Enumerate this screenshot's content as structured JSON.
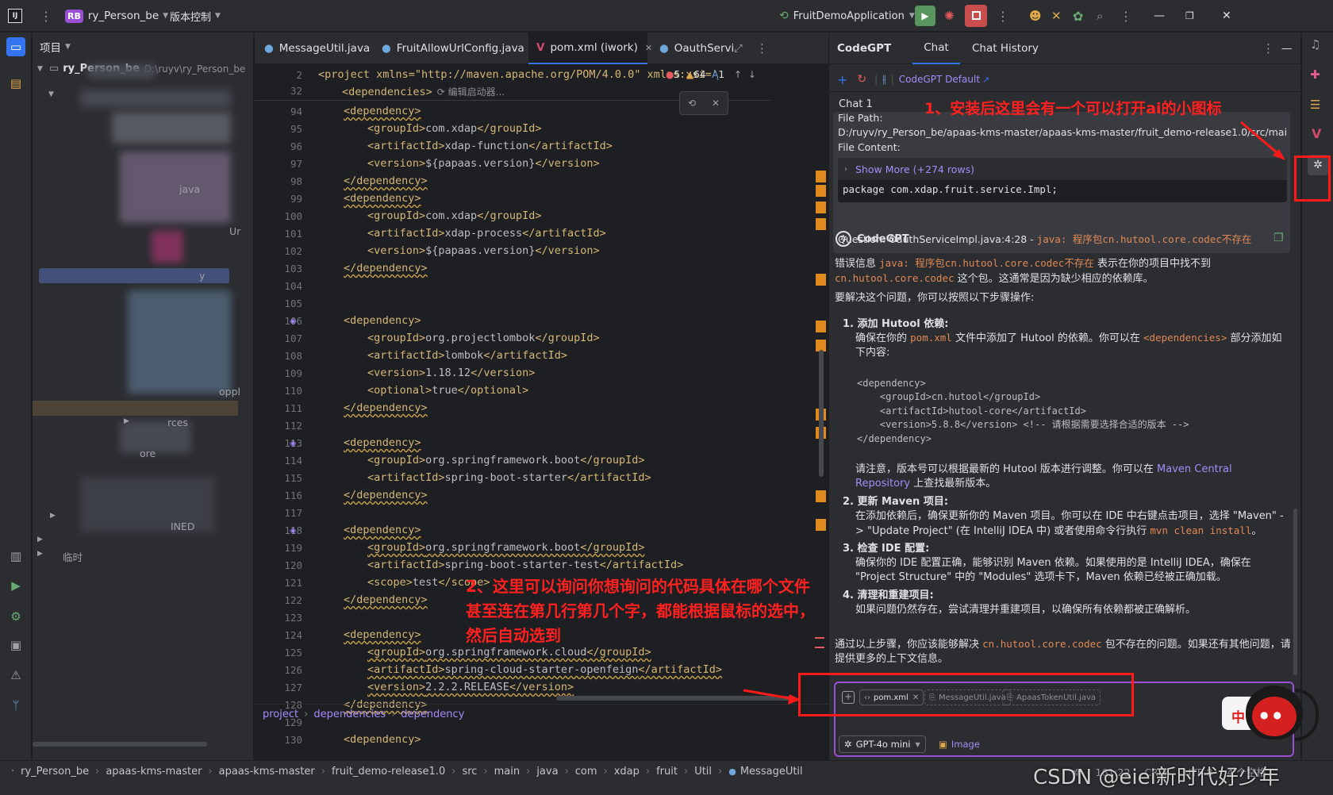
{
  "titlebar": {
    "project_initials": "RB",
    "project_name": "ry_Person_be",
    "vcs": "版本控制",
    "run_config": "FruitDemoApplication"
  },
  "project_panel": {
    "title": "项目",
    "root_name": "ry_Person_be",
    "root_path": "D:\\ruyv\\ry_Person_be",
    "items": [
      "java",
      "Ur",
      "y",
      "oppl",
      "rces",
      "ore",
      "INED",
      "临时"
    ]
  },
  "editor": {
    "tabs": [
      "MessageUtil.java",
      "FruitAllowUrlConfig.java",
      "pom.xml (iwork)",
      "OauthServi"
    ],
    "header_line": "<project xmlns=\"http://maven.apache.org/POM/4.0.0\" xmlns:xsi='",
    "deps_line": "<dependencies>",
    "inlay": "编辑启动器...",
    "problems": {
      "errors": "5",
      "warnings": "64",
      "typos": "1"
    },
    "lines": [
      {
        "n": "2",
        "t": ""
      },
      {
        "n": "32",
        "t": ""
      },
      {
        "n": "94",
        "t": "<dependency>",
        "i": 2
      },
      {
        "n": "95",
        "t": "<groupId>com.xdap</groupId>",
        "i": 3
      },
      {
        "n": "96",
        "t": "<artifactId>xdap-function</artifactId>",
        "i": 3
      },
      {
        "n": "97",
        "t": "<version>${papaas.version}</version>",
        "i": 3
      },
      {
        "n": "98",
        "t": "</dependency>",
        "i": 2
      },
      {
        "n": "99",
        "t": "<dependency>",
        "i": 2
      },
      {
        "n": "100",
        "t": "<groupId>com.xdap</groupId>",
        "i": 3
      },
      {
        "n": "101",
        "t": "<artifactId>xdap-process</artifactId>",
        "i": 3
      },
      {
        "n": "102",
        "t": "<version>${papaas.version}</version>",
        "i": 3
      },
      {
        "n": "103",
        "t": "</dependency>",
        "i": 2
      },
      {
        "n": "104",
        "t": ""
      },
      {
        "n": "105",
        "t": ""
      },
      {
        "n": "106",
        "t": "<dependency>",
        "i": 2
      },
      {
        "n": "107",
        "t": "<groupId>org.projectlombok</groupId>",
        "i": 3
      },
      {
        "n": "108",
        "t": "<artifactId>lombok</artifactId>",
        "i": 3
      },
      {
        "n": "109",
        "t": "<version>1.18.12</version>",
        "i": 3
      },
      {
        "n": "110",
        "t": "<optional>true</optional>",
        "i": 3
      },
      {
        "n": "111",
        "t": "</dependency>",
        "i": 2
      },
      {
        "n": "112",
        "t": ""
      },
      {
        "n": "113",
        "t": "<dependency>",
        "i": 2
      },
      {
        "n": "114",
        "t": "<groupId>org.springframework.boot</groupId>",
        "i": 3
      },
      {
        "n": "115",
        "t": "<artifactId>spring-boot-starter</artifactId>",
        "i": 3
      },
      {
        "n": "116",
        "t": "</dependency>",
        "i": 2
      },
      {
        "n": "117",
        "t": ""
      },
      {
        "n": "118",
        "t": "<dependency>",
        "i": 2
      },
      {
        "n": "119",
        "t": "<groupId>org.springframework.boot</groupId>",
        "i": 3
      },
      {
        "n": "120",
        "t": "<artifactId>spring-boot-starter-test</artifactId>",
        "i": 3
      },
      {
        "n": "121",
        "t": "<scope>test</scope>",
        "i": 3
      },
      {
        "n": "122",
        "t": "</dependency>",
        "i": 2
      },
      {
        "n": "123",
        "t": ""
      },
      {
        "n": "124",
        "t": "<dependency>",
        "i": 2
      },
      {
        "n": "125",
        "t": "<groupId>org.springframework.cloud</groupId>",
        "i": 3
      },
      {
        "n": "126",
        "t": "<artifactId>spring-cloud-starter-openfeign</artifactId>",
        "i": 3
      },
      {
        "n": "127",
        "t": "<version>2.2.2.RELEASE</version>",
        "i": 3
      },
      {
        "n": "128",
        "t": "</dependency>",
        "i": 2
      },
      {
        "n": "129",
        "t": ""
      },
      {
        "n": "130",
        "t": "<dependency>",
        "i": 2
      }
    ],
    "breadcrumbs": [
      "project",
      "dependencies",
      "dependency"
    ]
  },
  "codegpt": {
    "tabs": [
      "CodeGPT",
      "Chat",
      "Chat History"
    ],
    "toolbar_label": "CodeGPT Default",
    "chat_title": "Chat 1",
    "file_path_label": "File Path:",
    "file_path": "D:/ruyv/ry_Person_be/apaas-kms-master/apaas-kms-master/fruit_demo-release1.0/src/mai",
    "file_content_label": "File Content:",
    "show_more": "Show More (+274 rows)",
    "package_line": "package com.xdap.fruit.service.Impl;",
    "question_label": "Question: OauthServiceImpl.java:4:28 - ",
    "question_code": "java: 程序包cn.hutool.core.codec不存在",
    "answer_name": "CodeGPT",
    "p1a": "错误信息 ",
    "p1code": "java: 程序包cn.hutool.core.codec不存在",
    "p1b": " 表示在你的项目中找不到 ",
    "p1code2": "cn.hutool.core.codec",
    "p1c": " 这个包。这通常是因为缺少相应的依赖库。",
    "p2": "要解决这个问题，你可以按照以下步骤操作:",
    "s1_title": "添加 Hutool 依赖",
    "s1_a": "确保在你的 ",
    "s1_code": "pom.xml",
    "s1_b": " 文件中添加了 Hutool 的依赖。你可以在 ",
    "s1_code2": "<dependencies>",
    "s1_c": " 部分添加如下内容:",
    "code_block": [
      "<dependency>",
      "    <groupId>cn.hutool</groupId>",
      "    <artifactId>hutool-core</artifactId>",
      "    <version>5.8.8</version> <!-- 请根据需要选择合适的版本 -->",
      "</dependency>"
    ],
    "s1_note_a": "请注意，版本号可以根据最新的 Hutool 版本进行调整。你可以在 ",
    "s1_link": "Maven Central Repository",
    "s1_note_b": " 上查找最新版本。",
    "s2_title": "更新 Maven 项目",
    "s2_a": "在添加依赖后，确保更新你的 Maven 项目。你可以在 IDE 中右键点击项目，选择 \"Maven\" -> \"Update Project\" (在 IntelliJ IDEA 中) 或者使用命令行执行 ",
    "s2_code": "mvn clean install",
    "s2_b": "。",
    "s3_title": "检查 IDE 配置",
    "s3_text": "确保你的 IDE 配置正确，能够识别 Maven 依赖。如果使用的是 IntelliJ IDEA，确保在 \"Project Structure\" 中的 \"Modules\" 选项卡下，Maven 依赖已经被正确加载。",
    "s4_title": "清理和重建项目",
    "s4_text": "如果问题仍然存在，尝试清理并重建项目，以确保所有依赖都被正确解析。",
    "p3a": "通过以上步骤，你应该能够解决 ",
    "p3code": "cn.hutool.core.codec",
    "p3b": " 包不存在的问题。如果还有其他问题，请提供更多的上下文信息。",
    "input_chips": [
      "pom.xml",
      "MessageUtil.java",
      "ApaasTokenUtil.java"
    ],
    "model": "GPT-4o mini",
    "image_label": "Image"
  },
  "annotations": {
    "a1": "1、安装后这里会有一个可以打开ai的小图标",
    "a2": [
      "2、这里可以询问你想询问的代码具体在哪个文件",
      "甚至连在第几行第几个字，都能根据鼠标的选中，",
      "然后自动选到"
    ]
  },
  "statusbar": {
    "crumbs": [
      "ry_Person_be",
      "apaas-kms-master",
      "apaas-kms-master",
      "fruit_demo-release1.0",
      "src",
      "main",
      "java",
      "com",
      "xdap",
      "fruit",
      "Util",
      "MessageUtil"
    ],
    "position": "161:22",
    "line_sep": "CRLF",
    "encoding": "UTF-8",
    "indent": "4 个空格",
    "watermark": "CSDN @eiei新时代好少年"
  }
}
